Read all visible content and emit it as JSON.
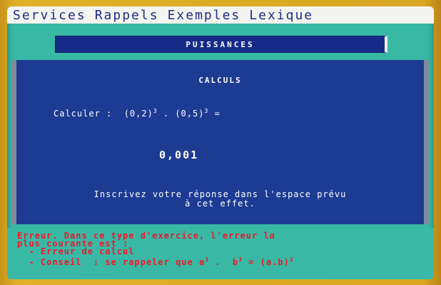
{
  "menubar": {
    "items": [
      "Services",
      "Rappels",
      "Exemples",
      "Lexique"
    ]
  },
  "banner": {
    "title": "PUISSANCES"
  },
  "panel": {
    "title": "CALCULS",
    "question_prefix": "Calculer :  (0,2)",
    "question_exp1": "3",
    "question_mid": " . (0,5)",
    "question_exp2": "3",
    "question_suffix": " =",
    "answer_value": "0,001",
    "instruction_line1": "Inscrivez votre réponse dans l'espace prévu",
    "instruction_line2": "à cet effet."
  },
  "error": {
    "line1": "Erreur. Dans ce type d'exercice, l'erreur la",
    "line2": "plus courante est :",
    "line3": "  - Erreur de calcul",
    "line4_prefix": "  - Conseil  : se rappeler que a",
    "line4_exp1": "3",
    "line4_mid": " .  b",
    "line4_exp2": "3",
    "line4_mid2": " = (a.b)",
    "line4_exp3": "3"
  },
  "colors": {
    "screen": "#39b9a5",
    "panel": "#1e3b93",
    "menu_text": "#1d2c8d",
    "error_text": "#f0162a"
  }
}
